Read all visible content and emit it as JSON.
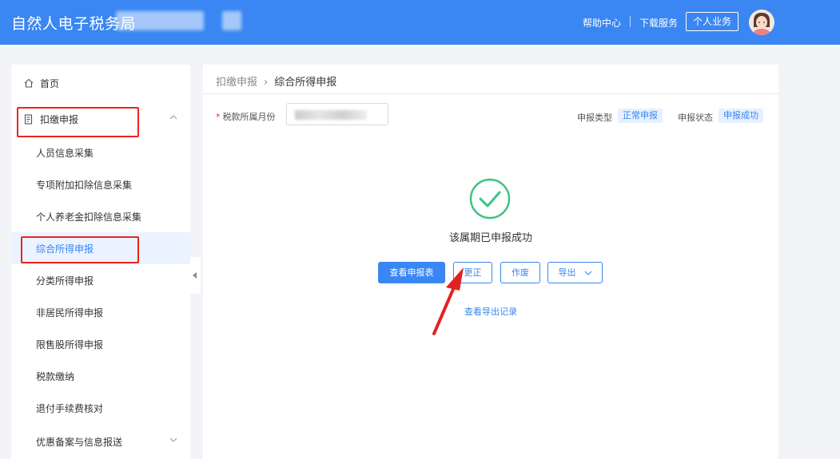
{
  "header": {
    "title": "自然人电子税务局",
    "help_center": "帮助中心",
    "download_service": "下载服务",
    "personal_business": "个人业务"
  },
  "sidebar": {
    "items": [
      {
        "label": "首页",
        "icon": "home-icon"
      },
      {
        "label": "扣缴申报",
        "icon": "document-icon",
        "expanded": true
      },
      {
        "label": "人员信息采集"
      },
      {
        "label": "专项附加扣除信息采集"
      },
      {
        "label": "个人养老金扣除信息采集"
      },
      {
        "label": "综合所得申报",
        "active": true
      },
      {
        "label": "分类所得申报"
      },
      {
        "label": "非居民所得申报"
      },
      {
        "label": "限售股所得申报"
      },
      {
        "label": "税款缴纳"
      },
      {
        "label": "退付手续费核对"
      },
      {
        "label": "优惠备案与信息报送",
        "expanded": false
      }
    ]
  },
  "main": {
    "breadcrumb": {
      "parent": "扣缴申报",
      "current": "综合所得申报"
    },
    "month_label": "税款所属月份",
    "required_mark": "*",
    "declare_type_label": "申报类型",
    "declare_type_value": "正常申报",
    "declare_status_label": "申报状态",
    "declare_status_value": "申报成功",
    "success_text": "该属期已申报成功",
    "buttons": {
      "view_report": "查看申报表",
      "correct": "更正",
      "void": "作废",
      "export": "导出"
    },
    "export_record_link": "查看导出记录"
  },
  "colors": {
    "brand": "#3a86f2",
    "success": "#3cc480",
    "highlight": "#e22222"
  }
}
